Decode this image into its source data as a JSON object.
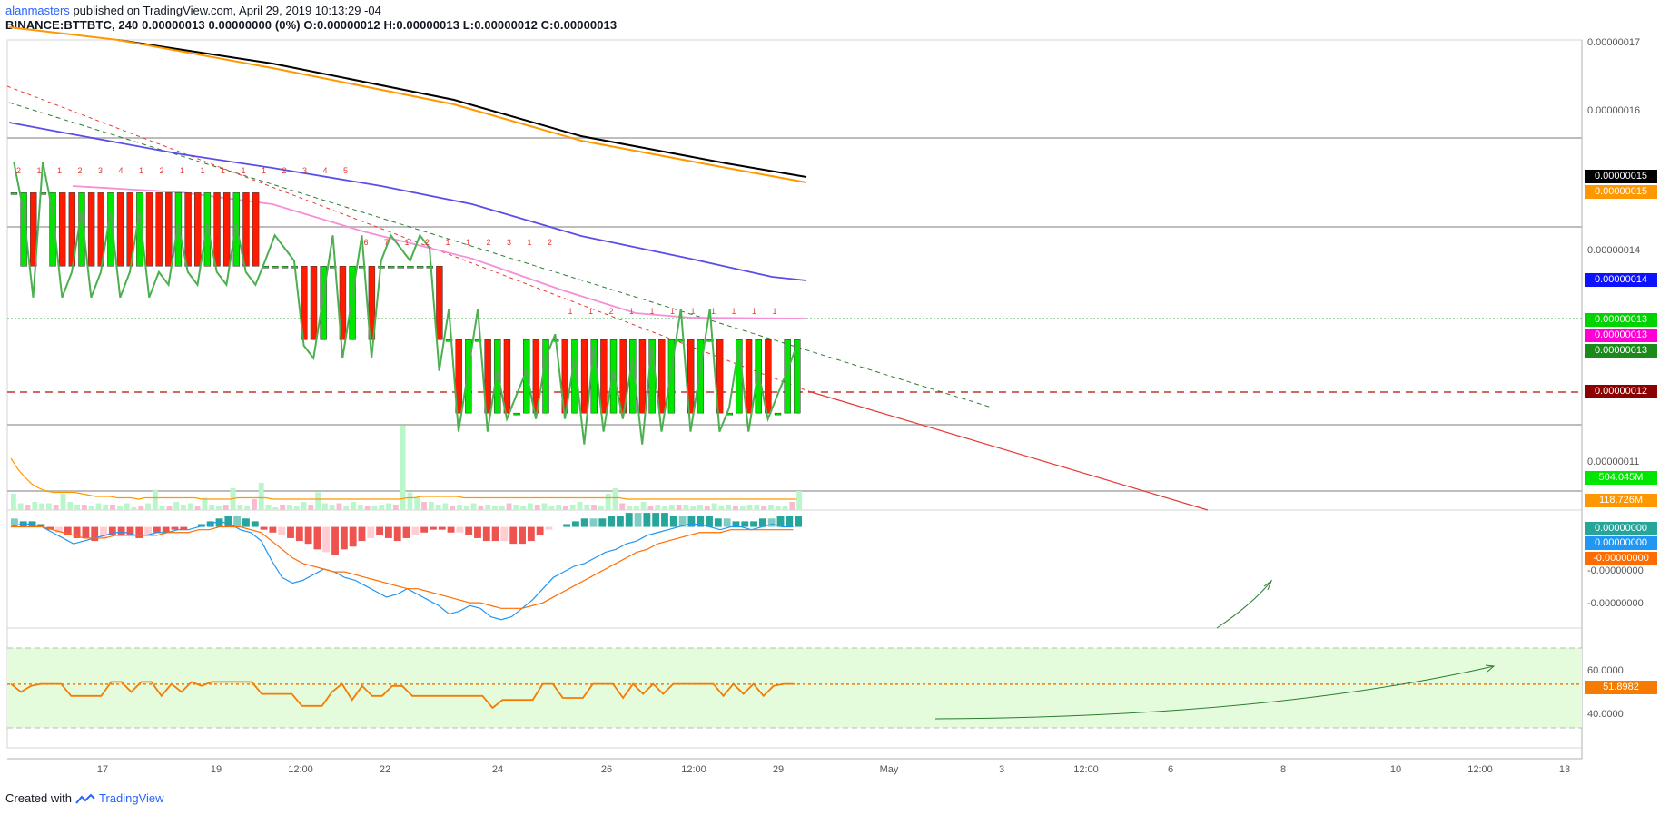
{
  "header": {
    "author": "alanmasters",
    "published": "published on TradingView.com, April 29, 2019 10:13:29 -04",
    "symbol_line": "BINANCE:BTTBTC, 240  0.00000013  0.00000000 (0%)  O:0.00000012  H:0.00000013  L:0.00000012  C:0.00000013"
  },
  "footer": {
    "created_with": "Created with",
    "brand": "TradingView"
  },
  "colors": {
    "up": "#00e600",
    "down": "#ff1a00",
    "ema_black": "#000000",
    "ema_orange": "#ff9800",
    "ema_blue": "#5b4de8",
    "ema_pink": "#f48fd8",
    "close_line": "#4caf50",
    "macd": "#2196f3",
    "signal": "#ff6d00",
    "rsi": "#f57c00",
    "rsi_fill": "#e4fbdc"
  },
  "chart_data": [
    {
      "type": "bar",
      "pane": "price",
      "symbol": "BINANCE:BTTBTC",
      "interval": "240",
      "x_ticks": [
        "17",
        "19",
        "12:00",
        "22",
        "24",
        "26",
        "12:00",
        "29",
        "May",
        "3",
        "12:00",
        "6",
        "8",
        "10",
        "12:00",
        "13"
      ],
      "y_ticks": [
        "0.00000017",
        "0.00000016",
        "0.00000015",
        "0.00000014",
        "0.00000013",
        "0.00000012",
        "0.00000011"
      ],
      "ylim": [
        1.068e-07,
        1.708e-07
      ],
      "candles": {
        "open": [
          1.5e-07,
          1.4e-07,
          1.5e-07,
          1.5e-07,
          1.4e-07,
          1.5e-07,
          1.5e-07,
          1.4e-07,
          1.5e-07,
          1.5e-07,
          1.4e-07,
          1.5e-07,
          1.5e-07,
          1.4e-07,
          1.5e-07,
          1.5e-07,
          1.5e-07,
          1.4e-07,
          1.5e-07,
          1.5e-07,
          1.4e-07,
          1.5e-07,
          1.5e-07,
          1.4e-07,
          1.5e-07,
          1.5e-07,
          1.4e-07,
          1.4e-07,
          1.4e-07,
          1.4e-07,
          1.4e-07,
          1.4e-07,
          1.3e-07,
          1.4e-07,
          1.4e-07,
          1.3e-07,
          1.4e-07,
          1.4e-07,
          1.4e-07,
          1.4e-07,
          1.4e-07,
          1.4e-07,
          1.4e-07,
          1.4e-07,
          1.4e-07,
          1.3e-07,
          1.3e-07,
          1.2e-07,
          1.3e-07,
          1.3e-07,
          1.2e-07,
          1.3e-07,
          1.2e-07,
          1.2e-07,
          1.3e-07,
          1.2e-07,
          1.3e-07,
          1.3e-07,
          1.2e-07,
          1.3e-07,
          1.2e-07,
          1.3e-07,
          1.2e-07,
          1.3e-07,
          1.2e-07,
          1.3e-07,
          1.2e-07,
          1.3e-07,
          1.2e-07,
          1.3e-07,
          1.3e-07,
          1.2e-07,
          1.3e-07,
          1.3e-07,
          1.2e-07,
          1.2e-07,
          1.3e-07,
          1.2e-07,
          1.3e-07,
          1.2e-07,
          1.2e-07,
          1.2e-07
        ],
        "close": [
          1.5e-07,
          1.5e-07,
          1.4e-07,
          1.5e-07,
          1.5e-07,
          1.4e-07,
          1.4e-07,
          1.5e-07,
          1.4e-07,
          1.4e-07,
          1.5e-07,
          1.4e-07,
          1.4e-07,
          1.5e-07,
          1.4e-07,
          1.4e-07,
          1.4e-07,
          1.5e-07,
          1.4e-07,
          1.4e-07,
          1.5e-07,
          1.4e-07,
          1.4e-07,
          1.5e-07,
          1.4e-07,
          1.4e-07,
          1.4e-07,
          1.4e-07,
          1.4e-07,
          1.4e-07,
          1.3e-07,
          1.3e-07,
          1.4e-07,
          1.4e-07,
          1.3e-07,
          1.4e-07,
          1.4e-07,
          1.3e-07,
          1.4e-07,
          1.4e-07,
          1.4e-07,
          1.4e-07,
          1.4e-07,
          1.4e-07,
          1.3e-07,
          1.3e-07,
          1.2e-07,
          1.3e-07,
          1.3e-07,
          1.2e-07,
          1.3e-07,
          1.2e-07,
          1.2e-07,
          1.3e-07,
          1.2e-07,
          1.3e-07,
          1.3e-07,
          1.2e-07,
          1.3e-07,
          1.2e-07,
          1.3e-07,
          1.2e-07,
          1.3e-07,
          1.2e-07,
          1.3e-07,
          1.2e-07,
          1.3e-07,
          1.2e-07,
          1.3e-07,
          1.3e-07,
          1.2e-07,
          1.3e-07,
          1.3e-07,
          1.2e-07,
          1.2e-07,
          1.3e-07,
          1.2e-07,
          1.3e-07,
          1.2e-07,
          1.2e-07,
          1.3e-07,
          1.3e-07
        ]
      },
      "markers": [
        "2",
        "1",
        "1",
        "2",
        "3",
        "4",
        "1",
        "2",
        "1",
        "1",
        "1",
        "1",
        "1",
        "2",
        "3",
        "4",
        "5",
        "6",
        "7",
        "1",
        "2",
        "1",
        "1",
        "2",
        "3",
        "1",
        "2",
        "1",
        "1",
        "2",
        "1",
        "1",
        "1",
        "1",
        "1",
        "1",
        "1",
        "1"
      ],
      "label_values": {
        "ema_black": "0.00000015",
        "ema_orange": "0.00000015",
        "ema_blue": "0.00000014",
        "last_close": "0.00000013",
        "ema_pink": "0.00000013",
        "close_avg": "0.00000013",
        "support": "0.00000012",
        "volume": "504.045M",
        "volume_ma": "118.726M"
      }
    },
    {
      "type": "bar",
      "pane": "volume",
      "values": [
        12,
        5,
        4,
        6,
        5,
        5,
        4,
        12,
        6,
        4,
        4,
        3,
        5,
        4,
        4,
        3,
        5,
        2,
        3,
        5,
        15,
        3,
        3,
        6,
        4,
        5,
        3,
        9,
        4,
        3,
        4,
        16,
        4,
        3,
        8,
        20,
        4,
        2,
        4,
        4,
        3,
        6,
        4,
        13,
        5,
        4,
        5,
        3,
        6,
        4,
        3,
        3,
        4,
        5,
        4,
        62,
        13,
        9,
        6,
        6,
        4,
        5,
        3,
        4,
        3,
        5,
        3,
        4,
        3,
        3,
        5,
        4,
        3,
        5,
        4,
        5,
        3,
        4,
        3,
        4,
        6,
        4,
        4,
        3,
        12,
        16,
        5,
        3,
        3,
        6,
        3,
        4,
        3,
        4,
        4,
        4,
        3,
        4,
        3,
        5,
        3,
        4,
        3,
        3,
        4,
        4,
        3,
        4,
        3,
        3,
        6,
        14
      ],
      "ma": [
        38,
        30,
        24,
        19,
        16,
        14,
        13,
        13,
        13,
        13,
        12,
        11,
        10,
        10,
        10,
        9,
        9,
        9,
        8,
        9,
        9,
        9,
        9,
        9,
        9,
        9,
        9,
        8,
        8,
        8,
        8,
        8,
        9,
        9,
        9,
        9,
        9,
        8,
        8,
        8,
        8,
        8,
        8,
        8,
        8,
        8,
        8,
        8,
        8,
        8,
        8,
        8,
        8,
        8,
        8,
        8,
        9,
        9,
        10,
        10,
        10,
        10,
        10,
        10,
        9,
        9,
        9,
        9,
        9,
        9,
        9,
        9,
        9,
        9,
        9,
        9,
        9,
        9,
        9,
        9,
        9,
        9,
        9,
        9,
        9,
        9,
        9,
        8,
        8,
        8,
        8,
        8,
        8,
        8,
        8,
        8,
        8,
        8,
        8,
        8,
        8,
        8,
        8,
        8,
        8,
        8,
        8,
        8,
        8,
        8,
        8,
        8
      ]
    },
    {
      "type": "bar",
      "pane": "macd",
      "y_ticks": [
        "-0.00000000",
        "-0.00000000"
      ],
      "label_values": {
        "histogram": "0.00000000",
        "macd": "0.00000000",
        "signal": "-0.00000000"
      },
      "histogram": [
        3,
        2,
        2,
        1,
        -1,
        -2,
        -3,
        -4,
        -4,
        -5,
        -4,
        -3,
        -3,
        -3,
        -4,
        -3,
        -2,
        -2,
        -1,
        -1,
        0,
        1,
        2,
        3,
        4,
        4,
        3,
        2,
        -1,
        -2,
        -3,
        -4,
        -5,
        -6,
        -8,
        -9,
        -10,
        -8,
        -7,
        -5,
        -4,
        -3,
        -4,
        -5,
        -4,
        -3,
        -2,
        -1,
        -1,
        -2,
        -2,
        -3,
        -4,
        -5,
        -5,
        -5,
        -6,
        -6,
        -5,
        -3,
        -1,
        0,
        1,
        2,
        3,
        3,
        3,
        4,
        4,
        5,
        5,
        5,
        5,
        5,
        4,
        4,
        4,
        4,
        4,
        3,
        3,
        2,
        2,
        2,
        3,
        3,
        4,
        4,
        4
      ],
      "macd": [
        0,
        1,
        1,
        0,
        -2,
        -4,
        -6,
        -5,
        -4,
        -3,
        -2,
        -2,
        -3,
        -3,
        -2,
        -2,
        -1,
        -1,
        0,
        1,
        2,
        1,
        -1,
        -2,
        -5,
        -12,
        -18,
        -20,
        -19,
        -17,
        -15,
        -16,
        -18,
        -19,
        -21,
        -23,
        -25,
        -24,
        -22,
        -24,
        -26,
        -28,
        -31,
        -30,
        -28,
        -29,
        -32,
        -33,
        -32,
        -29,
        -26,
        -22,
        -18,
        -16,
        -14,
        -13,
        -11,
        -9,
        -8,
        -6,
        -5,
        -3,
        -2,
        -1,
        0,
        1,
        1,
        0,
        -1,
        0,
        0,
        -1,
        0,
        1,
        0,
        0
      ],
      "signal": [
        0,
        0,
        0,
        0,
        -1,
        -2,
        -3,
        -4,
        -4,
        -4,
        -3,
        -3,
        -3,
        -3,
        -3,
        -2,
        -2,
        -2,
        -1,
        -1,
        0,
        0,
        0,
        -1,
        -2,
        -5,
        -8,
        -11,
        -13,
        -14,
        -15,
        -16,
        -16,
        -17,
        -18,
        -19,
        -20,
        -21,
        -22,
        -22,
        -23,
        -24,
        -25,
        -26,
        -27,
        -27,
        -28,
        -29,
        -29,
        -29,
        -28,
        -27,
        -25,
        -23,
        -21,
        -19,
        -17,
        -15,
        -13,
        -11,
        -9,
        -8,
        -6,
        -5,
        -4,
        -3,
        -2,
        -2,
        -2,
        -1,
        -1,
        -1,
        -1,
        -1,
        -1,
        -1
      ],
      "ylim": [
        -36,
        6
      ]
    },
    {
      "type": "line",
      "pane": "rsi",
      "y_ticks": [
        "60.0000",
        "40.0000"
      ],
      "ylim": [
        20,
        80
      ],
      "bands": [
        70,
        30
      ],
      "label_values": {
        "rsi": "51.8982"
      },
      "values": [
        52,
        48,
        51,
        52,
        52,
        52,
        46,
        46,
        46,
        46,
        53,
        53,
        48,
        53,
        53,
        46,
        52,
        48,
        53,
        51,
        53,
        53,
        53,
        53,
        53,
        47,
        47,
        47,
        47,
        41,
        41,
        41,
        48,
        52,
        44,
        51,
        46,
        46,
        51,
        51,
        46,
        46,
        46,
        46,
        46,
        46,
        46,
        46,
        40,
        44,
        44,
        44,
        44,
        52,
        52,
        45,
        45,
        45,
        52,
        52,
        52,
        45,
        52,
        47,
        52,
        47,
        52,
        52,
        52,
        52,
        52,
        46,
        52,
        47,
        52,
        46,
        51,
        52,
        52
      ]
    }
  ]
}
